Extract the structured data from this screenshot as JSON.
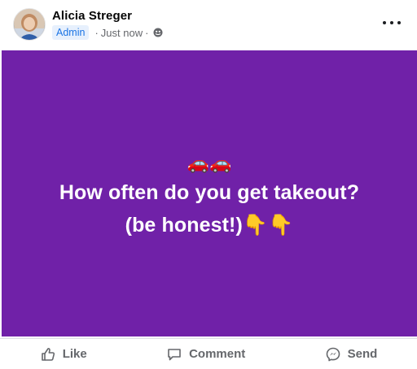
{
  "post": {
    "author_name": "Alicia Streger",
    "role_badge": "Admin",
    "separator": "·",
    "timestamp": "Just now",
    "privacy_icon": "globe-icon",
    "more_icon": "more-options-icon",
    "background_color": "#7021a8",
    "emoji_line": "🚗🚗",
    "headline_line1": "How often do you get takeout?",
    "headline_line2": "(be honest!)👇👇"
  },
  "actions": {
    "like_label": "Like",
    "comment_label": "Comment",
    "send_label": "Send"
  }
}
